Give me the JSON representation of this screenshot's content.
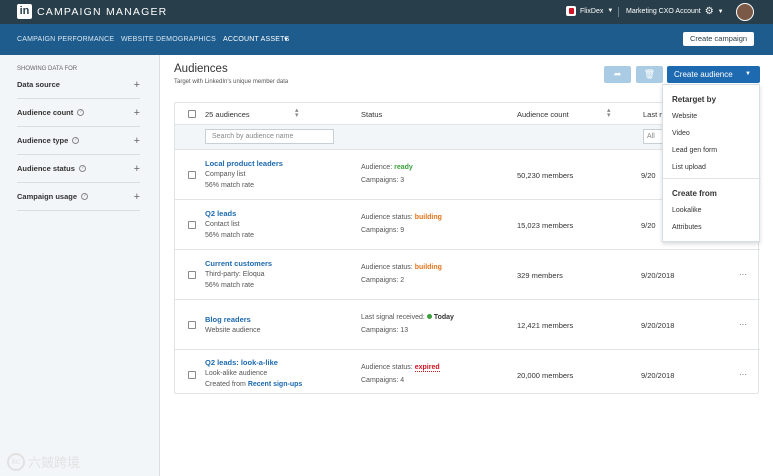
{
  "app": {
    "logo": "in",
    "title": "CAMPAIGN MANAGER"
  },
  "topbar": {
    "account1": "FlixDex",
    "account2": "Marketing CXO Account"
  },
  "nav": {
    "tabs": [
      "CAMPAIGN PERFORMANCE",
      "WEBSITE DEMOGRAPHICS",
      "ACCOUNT ASSETS"
    ],
    "active": "ACCOUNT ASSETS",
    "create_campaign": "Create campaign"
  },
  "sidebar": {
    "heading": "SHOWING DATA FOR",
    "filters": [
      "Data source",
      "Audience count",
      "Audience type",
      "Audience status",
      "Campaign usage"
    ]
  },
  "page": {
    "title": "Audiences",
    "subtitle": "Target with LinkedIn's unique member data",
    "create_audience": "Create audience"
  },
  "table": {
    "headers": {
      "audiences": "25 audiences",
      "status": "Status",
      "count": "Audience count",
      "last": "Last m"
    },
    "search_placeholder": "Search by audience name",
    "all_option": "All",
    "rows": [
      {
        "name": "Local product leaders",
        "type": "Company list",
        "extra": "56% match rate",
        "status_prefix": "Audience:",
        "status": "ready",
        "campaigns": "Campaigns: 3",
        "count": "50,230 members",
        "date": "9/20",
        "more": ""
      },
      {
        "name": "Q2 leads",
        "type": "Contact list",
        "extra": "56% match rate",
        "status_prefix": "Audience status:",
        "status": "building",
        "campaigns": "Campaigns: 9",
        "count": "15,023 members",
        "date": "9/20",
        "more": ""
      },
      {
        "name": "Current customers",
        "type": "Third-party: Eloqua",
        "extra": "56% match rate",
        "status_prefix": "Audience status:",
        "status": "building",
        "campaigns": "Campaigns: 2",
        "count": "329 members",
        "date": "9/20/2018",
        "more": "···"
      },
      {
        "name": "Blog readers",
        "type": "Website audience",
        "extra": "",
        "status_prefix": "Last signal received:",
        "status": "Today",
        "campaigns": "Campaigns: 13",
        "count": "12,421 members",
        "date": "9/20/2018",
        "more": "···"
      },
      {
        "name": "Q2 leads: look-a-like",
        "type": "Look-alike audience",
        "extra_prefix": "Created from",
        "extra_link": "Recent sign-ups",
        "status_prefix": "Audience status:",
        "status": "expired",
        "campaigns": "Campaigns: 4",
        "count": "20,000 members",
        "date": "9/20/2018",
        "more": "···"
      }
    ]
  },
  "dropdown": {
    "retarget_heading": "Retarget by",
    "retarget_items": [
      "Website",
      "Video",
      "Lead gen form",
      "List upload"
    ],
    "create_heading": "Create from",
    "create_items": [
      "Lookalike",
      "Attributes"
    ]
  },
  "watermark": {
    "text": "六皴跨境",
    "mark": "kc"
  },
  "colors": {
    "topbar": "#283e4a",
    "navbar": "#1d5c8c",
    "primary": "#1d6ab0",
    "ready": "#3ba03b",
    "building": "#e3741c",
    "expired": "#d11124"
  }
}
